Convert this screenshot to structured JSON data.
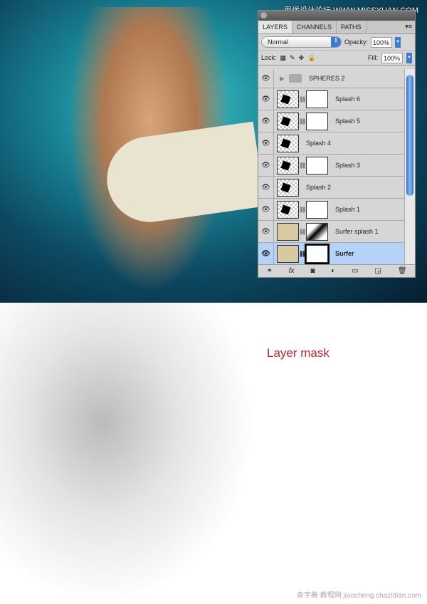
{
  "watermark_top": "思缘设计论坛 WWW.MISSYUAN.COM",
  "panel": {
    "tabs": [
      "LAYERS",
      "CHANNELS",
      "PATHS"
    ],
    "blend_mode": "Normal",
    "opacity_label": "Opacity:",
    "opacity": "100%",
    "lock_label": "Lock:",
    "fill_label": "Fill:",
    "fill": "100%",
    "layers": [
      {
        "name": "SPHERES 2",
        "type": "group"
      },
      {
        "name": "Splash 6"
      },
      {
        "name": "Splash 5"
      },
      {
        "name": "Splash 4"
      },
      {
        "name": "Splash 3"
      },
      {
        "name": "Splash 2"
      },
      {
        "name": "Splash 1"
      },
      {
        "name": "Surfer splash 1"
      },
      {
        "name": "Surfer",
        "selected": true
      }
    ]
  },
  "caption": "Layer mask",
  "watermark_bottom": "查字典 教程网 jiaocheng.chazidian.com",
  "colors": {
    "caption": "#c8242b",
    "selection": "#b5d3f9",
    "accent": "#3a7bd5"
  }
}
